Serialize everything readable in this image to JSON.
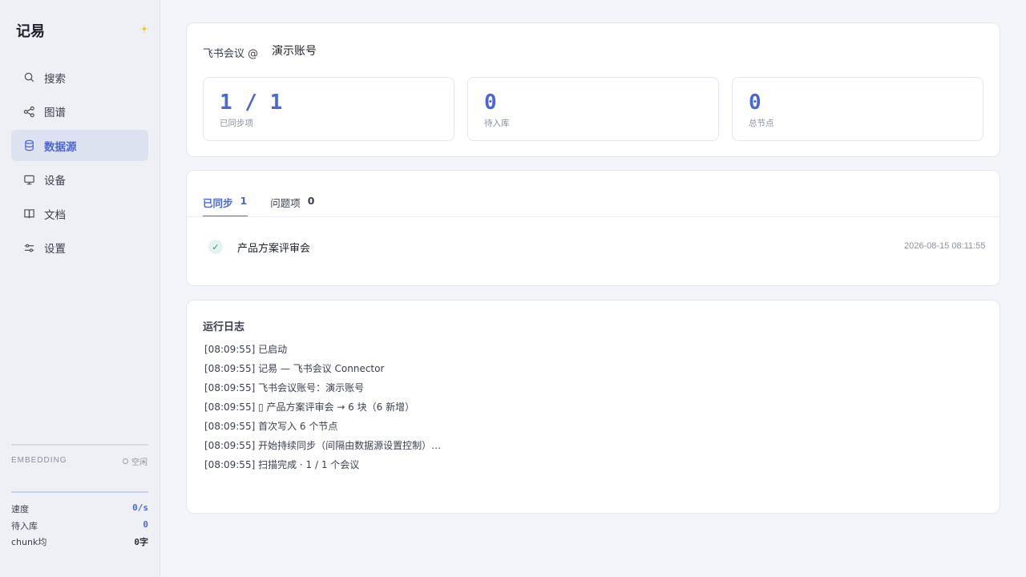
{
  "app": {
    "brand": "记易"
  },
  "sidebar": {
    "items": [
      {
        "label": "搜索",
        "icon": "search-icon"
      },
      {
        "label": "图谱",
        "icon": "share-graph-icon"
      },
      {
        "label": "数据源",
        "icon": "database-icon",
        "active": true
      },
      {
        "label": "设备",
        "icon": "monitor-icon"
      },
      {
        "label": "文档",
        "icon": "book-icon"
      },
      {
        "label": "设置",
        "icon": "sliders-icon"
      }
    ],
    "embedding": {
      "label": "EMBEDDING",
      "status": "空闲"
    },
    "stats": [
      {
        "label": "速度",
        "value": "0/s"
      },
      {
        "label": "待入库",
        "value": "0"
      },
      {
        "label": "chunk均",
        "value": "0字"
      }
    ]
  },
  "source": {
    "label": "飞书会议 @",
    "account": "演示账号"
  },
  "metrics": [
    {
      "value": "1 / 1",
      "caption": "已同步项"
    },
    {
      "value": "0",
      "caption": "待入库"
    },
    {
      "value": "0",
      "caption": "总节点"
    }
  ],
  "tabs": [
    {
      "label": "已同步",
      "count": "1",
      "active": true
    },
    {
      "label": "问题项",
      "count": "0"
    }
  ],
  "synced_items": [
    {
      "title": "产品方案评审会",
      "time": "2026-08-15 08:11:55"
    }
  ],
  "log": {
    "title": "运行日志",
    "lines": [
      "[08:09:55] 已启动",
      "[08:09:55] 记易 — 飞书会议 Connector",
      "[08:09:55] 飞书会议账号：演示账号",
      "[08:09:55] ▯  产品方案评审会 → 6 块（6 新增）",
      "[08:09:55] 首次写入 6 个节点",
      "[08:09:55] 开始持续同步（间隔由数据源设置控制）…",
      "[08:09:55] 扫描完成 ·  1 / 1 个会议"
    ]
  },
  "colors": {
    "accent": "#4a67d8",
    "success": "#249579"
  }
}
